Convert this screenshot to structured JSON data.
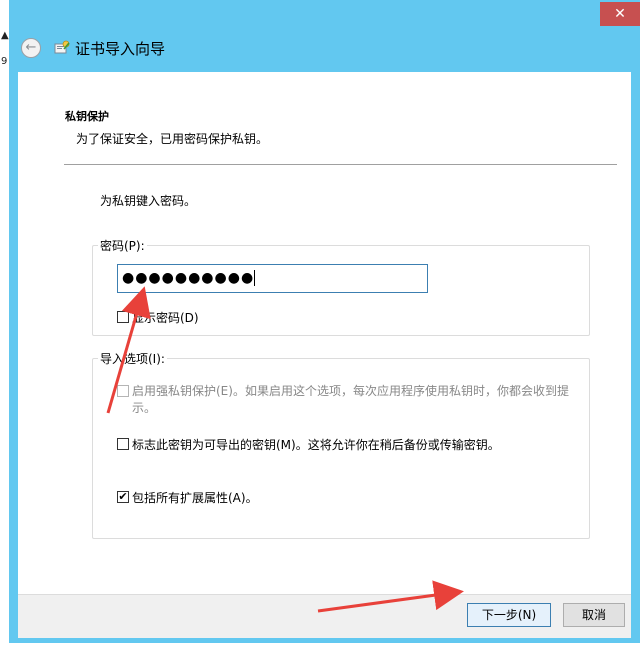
{
  "window": {
    "title": "证书导入向导",
    "close_label": "✕",
    "back_icon": "back-arrow-icon",
    "wizard_icon": "certificate-wizard-icon",
    "accent_color": "#62c8f0"
  },
  "background": {
    "left_mark_1": "▲",
    "left_mark_2": "9"
  },
  "page": {
    "section_title": "私钥保护",
    "section_subtitle": "为了保证安全，已用密码保护私钥。",
    "instruction": "为私钥键入密码。"
  },
  "password_group": {
    "label": "密码(P):",
    "value": "●●●●●●●●●●",
    "show_password_label": "显示密码(D)",
    "show_password_checked": false
  },
  "import_options": {
    "label": "导入选项(I):",
    "options": [
      {
        "label": "启用强私钥保护(E)。如果启用这个选项，每次应用程序使用私钥时，你都会收到提示。",
        "checked": false,
        "disabled": true
      },
      {
        "label": "标志此密钥为可导出的密钥(M)。这将允许你在稍后备份或传输密钥。",
        "checked": false,
        "disabled": false
      },
      {
        "label": "包括所有扩展属性(A)。",
        "checked": true,
        "disabled": false
      }
    ]
  },
  "footer": {
    "next_label": "下一步(N)",
    "cancel_label": "取消"
  },
  "annotation_color": "#e8413a"
}
